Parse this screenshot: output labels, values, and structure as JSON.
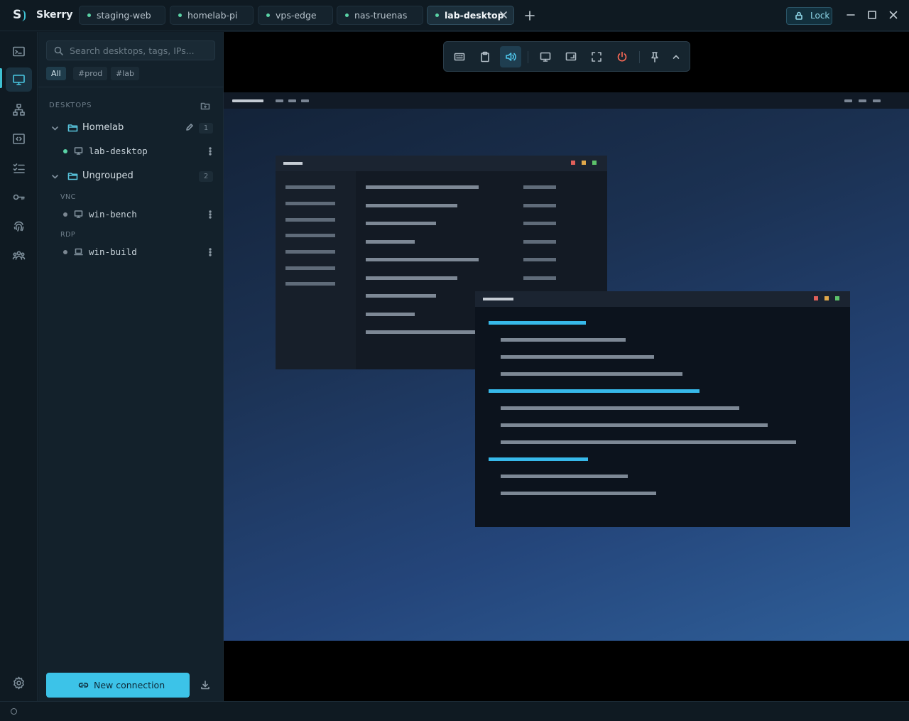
{
  "app": {
    "name": "Skerry"
  },
  "tabs": [
    {
      "label": "staging-web",
      "active": false
    },
    {
      "label": "homelab-pi",
      "active": false
    },
    {
      "label": "vps-edge",
      "active": false
    },
    {
      "label": "nas-truenas",
      "active": false
    },
    {
      "label": "lab-desktop",
      "active": true
    }
  ],
  "titlebar": {
    "lock_label": "Lock"
  },
  "rail": {
    "items": [
      "terminal-icon",
      "desktop-icon",
      "network-icon",
      "code-icon",
      "checklist-icon",
      "key-icon",
      "fingerprint-icon",
      "team-icon"
    ],
    "active": "desktop-icon"
  },
  "sidebar": {
    "search_placeholder": "Search desktops, tags, IPs...",
    "filters": [
      "All",
      "#prod",
      "#lab"
    ],
    "active_filter": "All",
    "section_title": "DESKTOPS",
    "groups": [
      {
        "name": "Homelab",
        "count": "1",
        "items": [
          {
            "name": "lab-desktop",
            "online": true
          }
        ]
      },
      {
        "name": "Ungrouped",
        "count": "2",
        "protocols": [
          {
            "label": "VNC",
            "items": [
              {
                "name": "win-bench",
                "online": false
              }
            ]
          },
          {
            "label": "RDP",
            "items": [
              {
                "name": "win-build",
                "online": false
              }
            ]
          }
        ]
      }
    ],
    "new_connection_label": "New connection"
  },
  "colors": {
    "accent": "#3cc3e8",
    "online": "#5ad3a6",
    "danger": "#ff6b57"
  }
}
